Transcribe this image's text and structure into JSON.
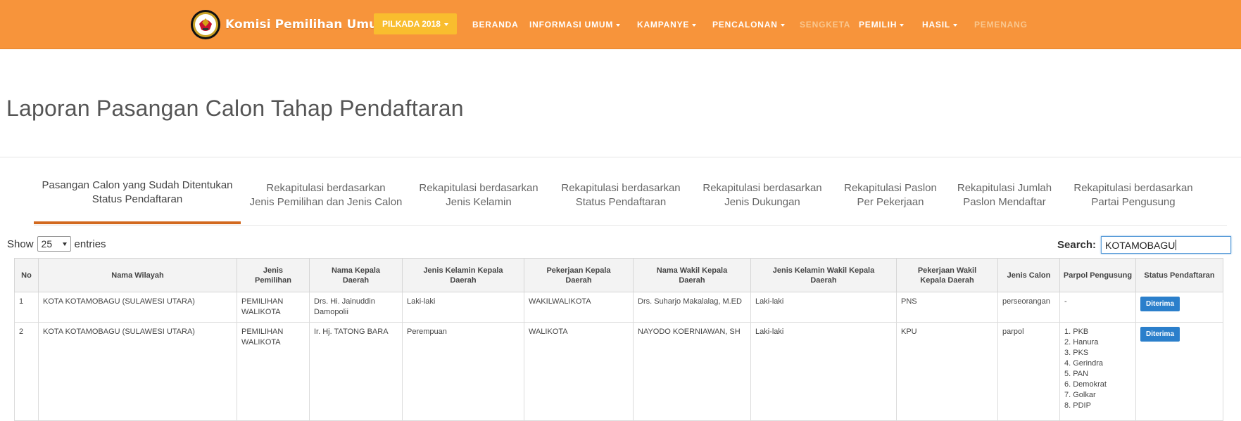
{
  "header": {
    "brand": "Komisi Pemilihan Umum",
    "pilkada_button": "PILKADA 2018",
    "nav": [
      {
        "label": "BERANDA",
        "dropdown": false,
        "disabled": false
      },
      {
        "label": "INFORMASI UMUM",
        "dropdown": true,
        "disabled": false
      },
      {
        "label": "KAMPANYE",
        "dropdown": true,
        "disabled": false
      },
      {
        "label": "PENCALONAN",
        "dropdown": true,
        "disabled": false
      },
      {
        "label": "SENGKETA",
        "dropdown": false,
        "disabled": true
      },
      {
        "label": "PEMILIH",
        "dropdown": true,
        "disabled": false
      },
      {
        "label": "HASIL",
        "dropdown": true,
        "disabled": false
      },
      {
        "label": "PEMENANG",
        "dropdown": false,
        "disabled": true
      }
    ]
  },
  "page_title": "Laporan Pasangan Calon Tahap Pendaftaran",
  "tabs": [
    {
      "line1": "Pasangan Calon yang Sudah Ditentukan",
      "line2": "Status Pendaftaran"
    },
    {
      "line1": "Rekapitulasi berdasarkan",
      "line2": "Jenis Pemilihan dan Jenis Calon"
    },
    {
      "line1": "Rekapitulasi berdasarkan",
      "line2": "Jenis Kelamin"
    },
    {
      "line1": "Rekapitulasi berdasarkan",
      "line2": "Status Pendaftaran"
    },
    {
      "line1": "Rekapitulasi berdasarkan",
      "line2": "Jenis Dukungan"
    },
    {
      "line1": "Rekapitulasi Paslon",
      "line2": "Per Pekerjaan"
    },
    {
      "line1": "Rekapitulasi Jumlah",
      "line2": "Paslon Mendaftar"
    },
    {
      "line1": "Rekapitulasi berdasarkan",
      "line2": "Partai Pengusung"
    }
  ],
  "controls": {
    "show_label": "Show",
    "entries_value": "25",
    "entries_label": "entries",
    "search_label": "Search:",
    "search_value": "KOTAMOBAGU"
  },
  "table": {
    "headers": {
      "no": "No",
      "wilayah": "Nama Wilayah",
      "jenis1": "Jenis",
      "jenis2": "Pemilihan",
      "kepala1": "Nama Kepala",
      "kepala2": "Daerah",
      "jkk1": "Jenis Kelamin Kepala",
      "jkk2": "Daerah",
      "pkk1": "Pekerjaan Kepala",
      "pkk2": "Daerah",
      "wakil1": "Nama Wakil Kepala",
      "wakil2": "Daerah",
      "jkw1": "Jenis Kelamin Wakil Kepala",
      "jkw2": "Daerah",
      "pkw1": "Pekerjaan Wakil",
      "pkw2": "Kepala Daerah",
      "calon": "Jenis Calon",
      "parpol": "Parpol Pengusung",
      "status": "Status Pendaftaran"
    },
    "rows": [
      {
        "no": "1",
        "wilayah": "KOTA KOTAMOBAGU (SULAWESI UTARA)",
        "jenis1": "PEMILIHAN",
        "jenis2": "WALIKOTA",
        "kepala1": "Drs. Hi. Jainuddin",
        "kepala2": "Damopolii",
        "jk_kepala": "Laki-laki",
        "pk_kepala": "WAKILWALIKOTA",
        "wakil": "Drs. Suharjo Makalalag, M.ED",
        "jk_wakil": "Laki-laki",
        "pk_wakil": "PNS",
        "calon": "perseorangan",
        "parpol": "-",
        "status": "Diterima"
      },
      {
        "no": "2",
        "wilayah": "KOTA KOTAMOBAGU (SULAWESI UTARA)",
        "jenis1": "PEMILIHAN",
        "jenis2": "WALIKOTA",
        "kepala": "Ir. Hj. TATONG BARA",
        "jk_kepala": "Perempuan",
        "pk_kepala": "WALIKOTA",
        "wakil": "NAYODO KOERNIAWAN, SH",
        "jk_wakil": "Laki-laki",
        "pk_wakil": "KPU",
        "calon": "parpol",
        "parpol_list": [
          "PKB",
          "Hanura",
          "PKS",
          "Gerindra",
          "PAN",
          "Demokrat",
          "Golkar",
          "PDIP"
        ],
        "status": "Diterima"
      }
    ]
  },
  "colors": {
    "navbar": "#f7943b",
    "pilkada": "#f9bd2e",
    "badge": "#2b7fcb",
    "tab_active": "#d2691e"
  }
}
